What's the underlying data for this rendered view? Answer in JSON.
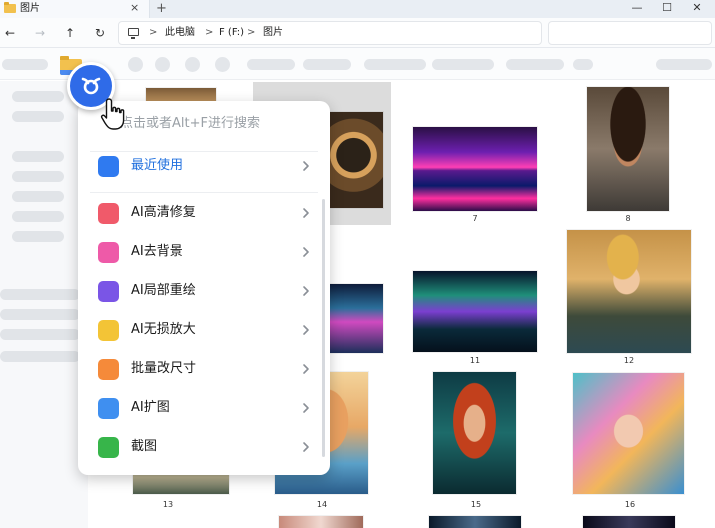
{
  "tab": {
    "title": "图片",
    "close_glyph": "×",
    "new_tab_glyph": "+"
  },
  "window_controls": {
    "minimize": "—",
    "maximize": "☐",
    "close": "✕"
  },
  "nav": {
    "back": "←",
    "forward": "→",
    "up": "↑",
    "refresh": "↻"
  },
  "breadcrumb": {
    "separator": ">",
    "items": [
      "此电脑",
      "F (F:)",
      "图片"
    ]
  },
  "menu": {
    "search_placeholder": "点击或者Alt+F进行搜索",
    "chevron": "›",
    "items": [
      {
        "label": "最近使用",
        "icon": "list-icon",
        "color": "#2f7af0",
        "active": true
      },
      {
        "label": "AI高清修复",
        "icon": "hd-image-icon",
        "color": "#f05a6a"
      },
      {
        "label": "AI去背景",
        "icon": "remove-background-icon",
        "color": "#ee5aa8"
      },
      {
        "label": "AI局部重绘",
        "icon": "brush-repaint-icon",
        "color": "#7a55e6"
      },
      {
        "label": "AI无损放大",
        "icon": "magnify-icon",
        "color": "#f3c436"
      },
      {
        "label": "批量改尺寸",
        "icon": "batch-resize-icon",
        "color": "#f58a3a"
      },
      {
        "label": "AI扩图",
        "icon": "image-expand-icon",
        "color": "#3f8ff0"
      },
      {
        "label": "截图",
        "icon": "crop-icon",
        "color": "#37b54a"
      }
    ]
  },
  "files": {
    "labels": [
      "7",
      "8",
      "11",
      "12",
      "13",
      "14",
      "15",
      "16"
    ]
  },
  "colors": {
    "accent": "#1f6fde",
    "fab": "#2f6be8",
    "selection": "#dcdcdc"
  }
}
